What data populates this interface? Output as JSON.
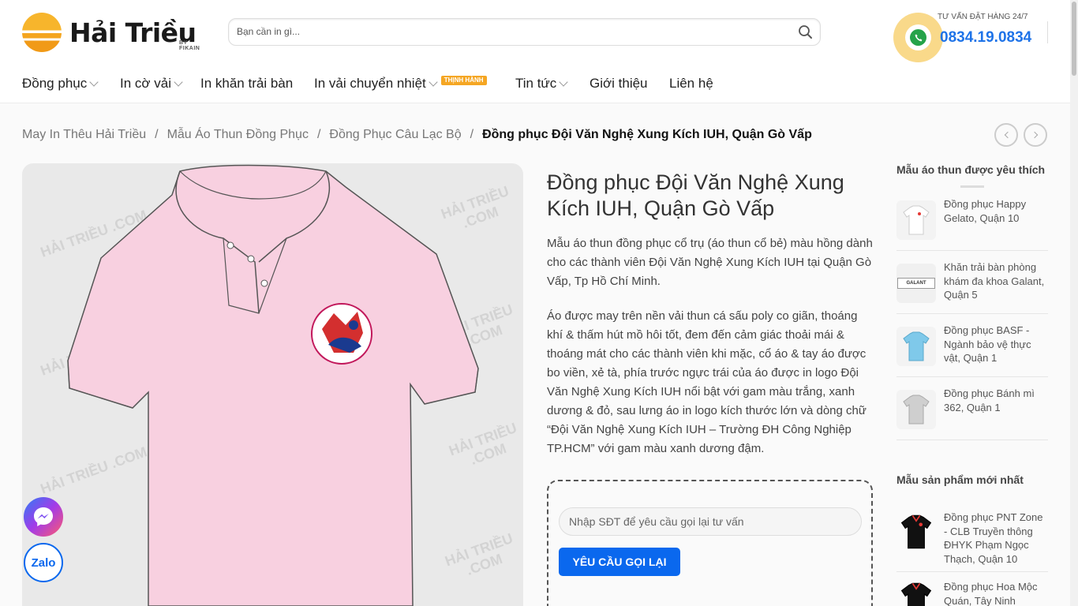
{
  "header": {
    "logo_text": "Hải Triều",
    "logo_sub": "BY FIKAIN",
    "search_placeholder": "Bạn cần in gì...",
    "hotline_label": "TƯ VẤN ĐẶT HÀNG 24/7",
    "hotline_phone": "0834.19.0834"
  },
  "nav": {
    "items": [
      {
        "label": "Đồng phục",
        "dropdown": true
      },
      {
        "label": "In cờ vải",
        "dropdown": true
      },
      {
        "label": "In khăn trải bàn",
        "dropdown": false
      },
      {
        "label": "In vải chuyển nhiệt",
        "dropdown": true,
        "badge": "THỊNH HÀNH"
      },
      {
        "label": "Tin tức",
        "dropdown": true
      },
      {
        "label": "Giới thiệu",
        "dropdown": false
      },
      {
        "label": "Liên hệ",
        "dropdown": false
      }
    ]
  },
  "breadcrumb": [
    "May In Thêu Hải Triều",
    "Mẫu Áo Thun Đồng Phục",
    "Đồng Phục Câu Lạc Bộ",
    "Đồng phục Đội Văn Nghệ Xung Kích IUH, Quận Gò Vấp"
  ],
  "product": {
    "title": "Đồng phục Đội Văn Nghệ Xung Kích IUH, Quận Gò Vấp",
    "description_1": "Mẫu áo thun đồng phục cổ trụ (áo thun cổ bẻ) màu hồng dành cho các thành viên Đội Văn Nghệ Xung Kích IUH tại Quận Gò Vấp, Tp Hồ Chí Minh.",
    "description_2": "Áo được may trên nền vải thun cá sấu poly co giãn, thoáng khí & thấm hút mồ hôi tốt, đem đến cảm giác thoải mái & thoáng mát cho các thành viên khi mặc, cổ áo & tay áo được bo viền, xẻ tà, phía trước ngực trái của áo được in logo Đội Văn Nghệ Xung Kích IUH nổi bật với gam màu trắng, xanh dương & đỏ, sau lưng áo in logo kích thước lớn và dòng chữ “Đội Văn Nghệ Xung Kích IUH – Trường ĐH Công Nghiệp TP.HCM” với gam màu xanh dương đậm.",
    "shirt_color": "#f8d0e0",
    "watermark": "HẢI TRIỀU .COM"
  },
  "callback": {
    "placeholder": "Nhập SĐT để yêu cầu gọi lại tư vấn",
    "button_label": "YÊU CẦU GỌI LẠI"
  },
  "sidebar": {
    "favorite_title": "Mẫu áo thun được yêu thích",
    "favorites": [
      {
        "name": "Đồng phục Happy Gelato, Quận 10",
        "thumb_color": "#ffffff"
      },
      {
        "name": "Khăn trải bàn phòng khám đa khoa Galant, Quận 5",
        "thumb_color": "#f0f0f0",
        "thumb_text": "GALANT"
      },
      {
        "name": "Đồng phục BASF - Ngành bảo vệ thực vật, Quận 1",
        "thumb_color": "#7fc9ea"
      },
      {
        "name": "Đồng phục Bánh mì 362, Quận 1",
        "thumb_color": "#c9c9c9"
      }
    ],
    "newest_title": "Mẫu sản phẩm mới nhất",
    "newest": [
      {
        "name": "Đồng phục PNT Zone - CLB Truyền thông ĐHYK Phạm Ngọc Thạch, Quận 10",
        "thumb_color": "#111111"
      },
      {
        "name": "Đồng phục Hoa Mộc Quán, Tây Ninh",
        "thumb_color": "#111111"
      }
    ]
  },
  "floating": {
    "zalo_label": "Zalo"
  },
  "colors": {
    "accent": "#1e73e8",
    "button": "#0a68ee",
    "badge": "#f5a623"
  }
}
